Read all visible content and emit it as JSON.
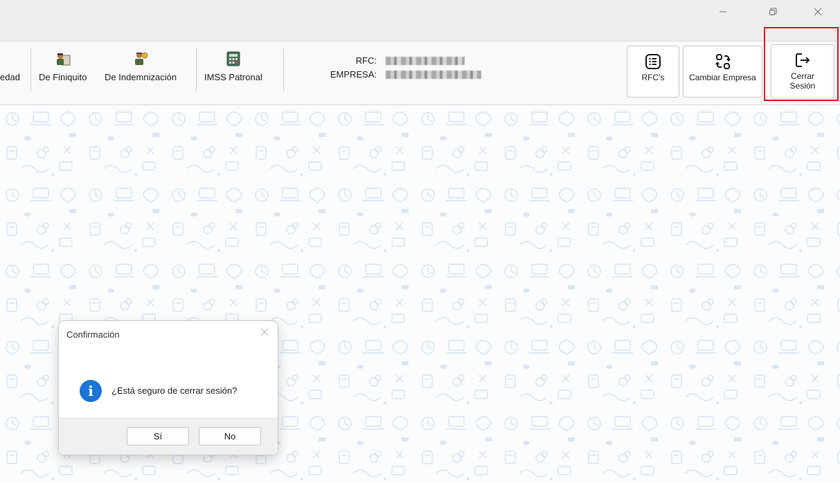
{
  "window": {
    "controls": {
      "minimize": "minimize-icon",
      "restore": "restore-icon",
      "close": "close-icon"
    }
  },
  "toolbar": {
    "items": [
      {
        "label": "edad",
        "icon": "partial-menu-item"
      },
      {
        "label": "De Finiquito",
        "icon": "worker-document-icon"
      },
      {
        "label": "De Indemnización",
        "icon": "money-person-icon"
      },
      {
        "label": "IMSS Patronal",
        "icon": "calculator-icon"
      }
    ],
    "rfc_label": "RFC:",
    "empresa_label": "EMPRESA:",
    "buttons": {
      "rfcs": "RFC's",
      "cambiar_empresa": "Cambiar Empresa",
      "cerrar_line1": "Cerrar",
      "cerrar_line2": "Sesión"
    }
  },
  "highlight_color": "#e0141b",
  "dialog": {
    "title": "Confirmación",
    "message": "¿Está seguro de cerrar sesión?",
    "icon": "info-icon",
    "yes_label": "Sí",
    "no_label": "No"
  }
}
